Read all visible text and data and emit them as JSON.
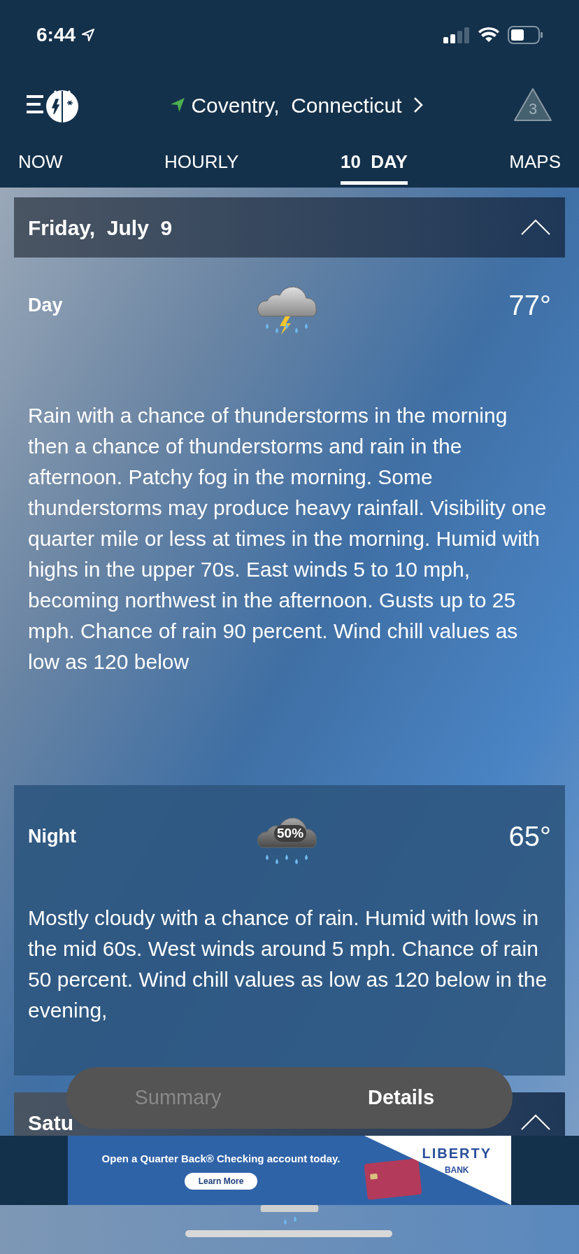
{
  "status_bar": {
    "time": "6:44"
  },
  "nav": {
    "location": "Coventry,  Connecticut",
    "alert_count": "3"
  },
  "tabs": [
    {
      "label": "NOW",
      "selected": false
    },
    {
      "label": "HOURLY",
      "selected": false
    },
    {
      "label": "10  DAY",
      "selected": true
    },
    {
      "label": "MAPS",
      "selected": false
    }
  ],
  "days": [
    {
      "date": "Friday,  July  9",
      "expanded": true,
      "periods": [
        {
          "kind": "day",
          "label": "Day",
          "temp": "77°",
          "description": "Rain with a chance of thunderstorms in the morning  then a chance of thunderstorms and rain in the afternoon. Patchy fog in the morning. Some thunderstorms may produce heavy rainfall. Visibility one quarter mile or less at times in the morning. Humid with highs in the upper 70s. East winds 5 to 10 mph, becoming northwest in the afternoon. Gusts up to 25 mph. Chance of rain 90 percent. Wind chill values as low as 120 below"
        },
        {
          "kind": "night",
          "label": "Night",
          "temp": "65°",
          "chance": "50%",
          "description": "Mostly cloudy with a chance of rain. Humid with lows in the mid 60s. West winds around 5 mph. Chance of rain 50 percent. Wind chill values as low as 120 below in the evening,"
        }
      ]
    },
    {
      "date": "Satu",
      "expanded": true
    }
  ],
  "view_toggle": [
    {
      "label": "Summary",
      "selected": false
    },
    {
      "label": "Details",
      "selected": true
    }
  ],
  "ad": {
    "headline": "Open a Quarter Back® Checking account today.",
    "button": "Learn More",
    "brand": "LIBERTY",
    "brand_sub": "BANK"
  }
}
